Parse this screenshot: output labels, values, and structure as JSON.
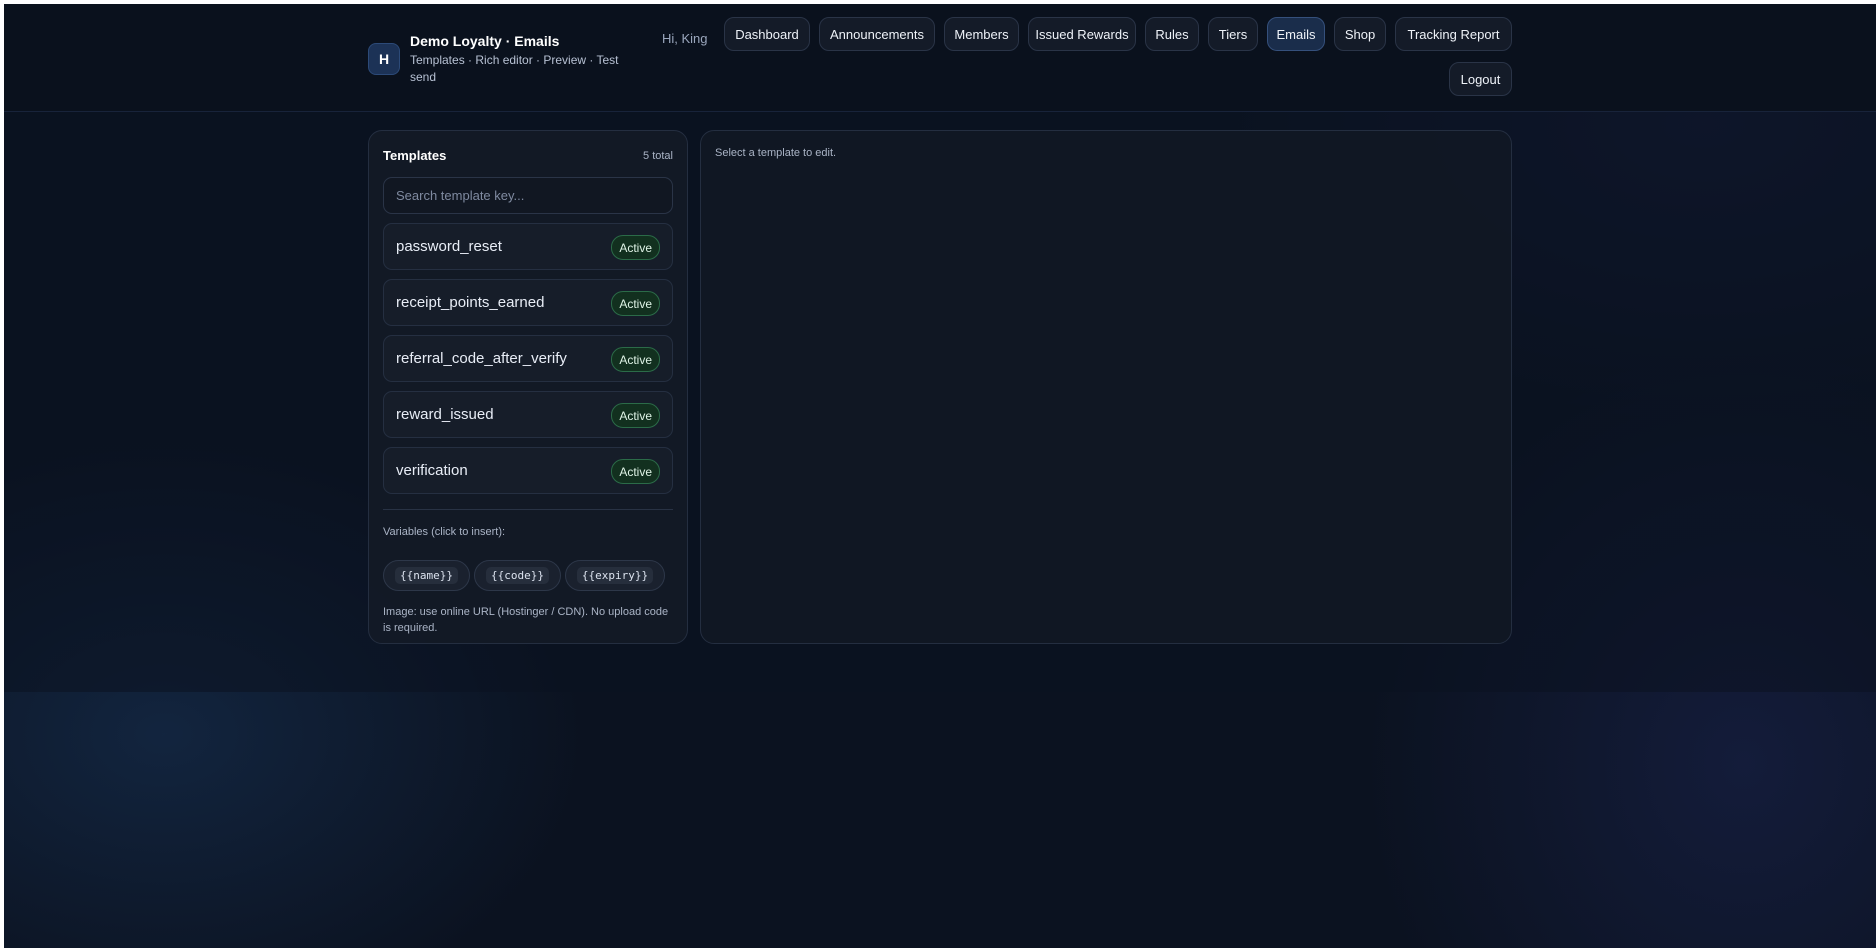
{
  "header": {
    "logo_letter": "H",
    "title": "Demo Loyalty · Emails",
    "subtitle": "Templates · Rich editor · Preview · Test send",
    "greeting": "Hi, King"
  },
  "nav": {
    "dashboard": "Dashboard",
    "announcements": "Announcements",
    "members": "Members",
    "issued_rewards": "Issued Rewards",
    "rules": "Rules",
    "tiers": "Tiers",
    "emails": "Emails",
    "shop": "Shop",
    "tracking_report": "Tracking Report",
    "logout": "Logout",
    "active": "Emails"
  },
  "templates": {
    "title": "Templates",
    "count": "5 total",
    "search_placeholder": "Search template key...",
    "items": [
      {
        "key": "password_reset",
        "status": "Active"
      },
      {
        "key": "receipt_points_earned",
        "status": "Active"
      },
      {
        "key": "referral_code_after_verify",
        "status": "Active"
      },
      {
        "key": "reward_issued",
        "status": "Active"
      },
      {
        "key": "verification",
        "status": "Active"
      }
    ],
    "variables_label": "Variables (click to insert):",
    "variables": [
      "{{name}}",
      "{{code}}",
      "{{expiry}}"
    ],
    "image_note": "Image: use online URL (Hostinger / CDN). No upload code is required."
  },
  "editor": {
    "empty_hint": "Select a template to edit."
  },
  "colors": {
    "background": "#0b1220",
    "active_badge": "#12301f",
    "active_nav": "#1a2d4b"
  }
}
